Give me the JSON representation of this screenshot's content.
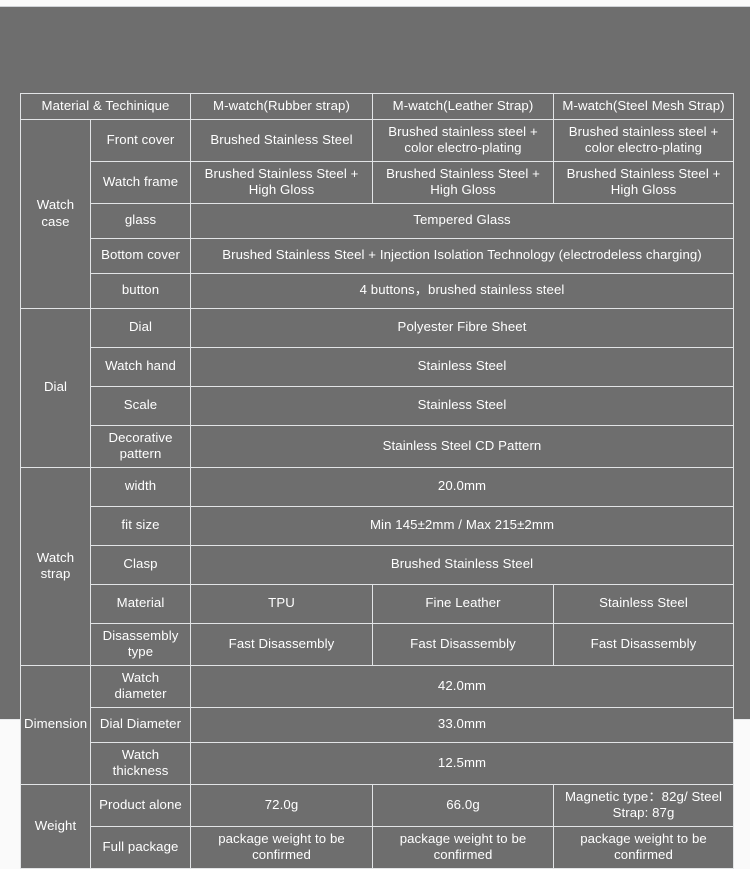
{
  "document": {
    "kind": "product-specification-table",
    "background_color": "#6e6e6e",
    "border_color": "#e2e4e6",
    "text_color": "#ffffff"
  },
  "table": {
    "header": {
      "spec_label": "Material & Techinique",
      "columns": [
        "M-watch(Rubber strap)",
        "M-watch(Leather Strap)",
        "M-watch(Steel Mesh Strap)"
      ]
    },
    "groups": [
      {
        "label": "Watch case",
        "rows": [
          {
            "label": "Front cover",
            "cells": [
              "Brushed Stainless Steel",
              "Brushed stainless steel + color electro-plating",
              "Brushed stainless steel + color electro-plating"
            ]
          },
          {
            "label": "Watch frame",
            "cells": [
              "Brushed Stainless Steel + High Gloss",
              "Brushed Stainless Steel + High Gloss",
              "Brushed Stainless Steel + High Gloss"
            ]
          },
          {
            "label": "glass",
            "merged": "Tempered Glass"
          },
          {
            "label": "Bottom cover",
            "merged": "Brushed Stainless Steel + Injection Isolation Technology (electrodeless charging)"
          },
          {
            "label": "button",
            "merged": "4 buttons，brushed stainless steel"
          }
        ]
      },
      {
        "label": "Dial",
        "rows": [
          {
            "label": "Dial",
            "merged": "Polyester Fibre Sheet"
          },
          {
            "label": "Watch hand",
            "merged": "Stainless Steel"
          },
          {
            "label": "Scale",
            "merged": "Stainless Steel"
          },
          {
            "label": "Decorative pattern",
            "merged": "Stainless Steel CD Pattern"
          }
        ]
      },
      {
        "label": "Watch strap",
        "rows": [
          {
            "label": "width",
            "merged": "20.0mm"
          },
          {
            "label": "fit size",
            "merged": "Min 145±2mm / Max 215±2mm"
          },
          {
            "label": "Clasp",
            "merged": "Brushed Stainless Steel"
          },
          {
            "label": "Material",
            "cells": [
              "TPU",
              "Fine Leather",
              "Stainless Steel"
            ]
          },
          {
            "label": "Disassembly type",
            "cells": [
              "Fast Disassembly",
              "Fast Disassembly",
              "Fast Disassembly"
            ]
          }
        ]
      },
      {
        "label": "Dimension",
        "rows": [
          {
            "label": "Watch diameter",
            "merged": "42.0mm"
          },
          {
            "label": "Dial Diameter",
            "merged": "33.0mm"
          },
          {
            "label": "Watch thickness",
            "merged": "12.5mm"
          }
        ]
      },
      {
        "label": "Weight",
        "rows": [
          {
            "label": "Product alone",
            "cells": [
              "72.0g",
              "66.0g",
              "Magnetic type：82g/ Steel Strap: 87g"
            ]
          },
          {
            "label": "Full package",
            "cells": [
              "package weight to be confirmed",
              "package weight to be confirmed",
              "package weight to be confirmed"
            ]
          }
        ]
      }
    ]
  }
}
